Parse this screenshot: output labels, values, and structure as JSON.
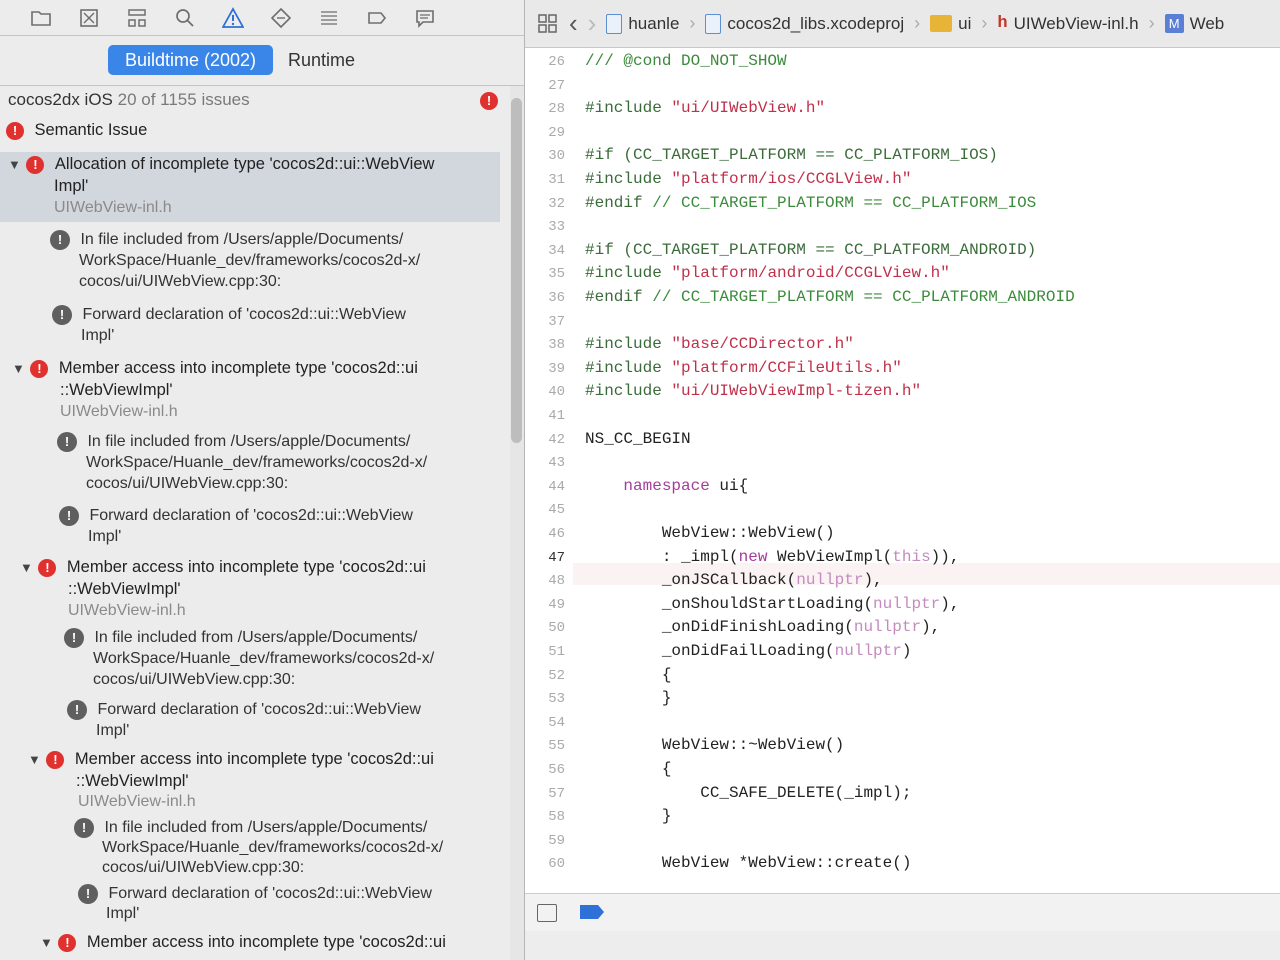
{
  "toolbar_icons": [
    "folder-icon",
    "source-control-icon",
    "hierarchy-icon",
    "search-icon",
    "warning-icon",
    "test-icon",
    "debug-icon",
    "breakpoint-icon",
    "report-icon"
  ],
  "scope": {
    "buildtime_label": "Buildtime (2002)",
    "runtime_label": "Runtime"
  },
  "summary": {
    "project": "cocos2dx iOS",
    "count": "20 of 1155 issues",
    "error_badge": "!"
  },
  "category": "Semantic Issue",
  "issues": [
    {
      "title_l1": "Allocation of incomplete type 'cocos2d::ui::WebView",
      "title_l2": "Impl'",
      "file": "UIWebView-inl.h",
      "note1_l1": "In file included from /Users/apple/Documents/",
      "note1_l2": "WorkSpace/Huanle_dev/frameworks/cocos2d-x/",
      "note1_l3": "cocos/ui/UIWebView.cpp:30:",
      "note2_l1": "Forward declaration of 'cocos2d::ui::WebView",
      "note2_l2": "Impl'"
    },
    {
      "title_l1": "Member access into incomplete type 'cocos2d::ui",
      "title_l2": "::WebViewImpl'",
      "file": "UIWebView-inl.h",
      "note1_l1": "In file included from /Users/apple/Documents/",
      "note1_l2": "WorkSpace/Huanle_dev/frameworks/cocos2d-x/",
      "note1_l3": "cocos/ui/UIWebView.cpp:30:",
      "note2_l1": "Forward declaration of 'cocos2d::ui::WebView",
      "note2_l2": "Impl'"
    },
    {
      "title_l1": "Member access into incomplete type 'cocos2d::ui",
      "title_l2": "::WebViewImpl'",
      "file": "UIWebView-inl.h",
      "note1_l1": "In file included from /Users/apple/Documents/",
      "note1_l2": "WorkSpace/Huanle_dev/frameworks/cocos2d-x/",
      "note1_l3": "cocos/ui/UIWebView.cpp:30:",
      "note2_l1": "Forward declaration of 'cocos2d::ui::WebView",
      "note2_l2": "Impl'"
    },
    {
      "title_l1": "Member access into incomplete type 'cocos2d::ui",
      "title_l2": "::WebViewImpl'",
      "file": "UIWebView-inl.h",
      "note1_l1": "In file included from /Users/apple/Documents/",
      "note1_l2": "WorkSpace/Huanle_dev/frameworks/cocos2d-x/",
      "note1_l3": "cocos/ui/UIWebView.cpp:30:",
      "note2_l1": "Forward declaration of 'cocos2d::ui::WebView",
      "note2_l2": "Impl'"
    },
    {
      "title_l1": "Member access into incomplete type 'cocos2d::ui"
    }
  ],
  "jumpbar": {
    "project": "huanle",
    "xcodeproj": "cocos2d_libs.xcodeproj",
    "folder": "ui",
    "file": "UIWebView-inl.h",
    "symbol": "Web",
    "h_glyph": "h",
    "m_glyph": "M"
  },
  "code": {
    "current_line": "47",
    "lines": [
      {
        "n": "26",
        "parts": [
          {
            "c": "cm",
            "t": "/// @cond DO_NOT_SHOW"
          }
        ]
      },
      {
        "n": "27",
        "parts": []
      },
      {
        "n": "28",
        "parts": [
          {
            "c": "pp",
            "t": "#include "
          },
          {
            "c": "str",
            "t": "\"ui/UIWebView.h\""
          }
        ]
      },
      {
        "n": "29",
        "parts": []
      },
      {
        "n": "30",
        "parts": [
          {
            "c": "pp",
            "t": "#if (CC_TARGET_PLATFORM == CC_PLATFORM_IOS)"
          }
        ]
      },
      {
        "n": "31",
        "parts": [
          {
            "c": "pp",
            "t": "#include "
          },
          {
            "c": "str",
            "t": "\"platform/ios/CCGLView.h\""
          }
        ]
      },
      {
        "n": "32",
        "parts": [
          {
            "c": "pp",
            "t": "#endif "
          },
          {
            "c": "cm",
            "t": "// CC_TARGET_PLATFORM == CC_PLATFORM_IOS"
          }
        ]
      },
      {
        "n": "33",
        "parts": []
      },
      {
        "n": "34",
        "parts": [
          {
            "c": "pp",
            "t": "#if (CC_TARGET_PLATFORM == CC_PLATFORM_ANDROID)"
          }
        ]
      },
      {
        "n": "35",
        "parts": [
          {
            "c": "pp",
            "t": "#include "
          },
          {
            "c": "str",
            "t": "\"platform/android/CCGLView.h\""
          }
        ]
      },
      {
        "n": "36",
        "parts": [
          {
            "c": "pp",
            "t": "#endif "
          },
          {
            "c": "cm",
            "t": "// CC_TARGET_PLATFORM == CC_PLATFORM_ANDROID"
          }
        ]
      },
      {
        "n": "37",
        "parts": []
      },
      {
        "n": "38",
        "parts": [
          {
            "c": "pp",
            "t": "#include "
          },
          {
            "c": "str",
            "t": "\"base/CCDirector.h\""
          }
        ]
      },
      {
        "n": "39",
        "parts": [
          {
            "c": "pp",
            "t": "#include "
          },
          {
            "c": "str",
            "t": "\"platform/CCFileUtils.h\""
          }
        ]
      },
      {
        "n": "40",
        "parts": [
          {
            "c": "pp",
            "t": "#include "
          },
          {
            "c": "str",
            "t": "\"ui/UIWebViewImpl-tizen.h\""
          }
        ]
      },
      {
        "n": "41",
        "parts": []
      },
      {
        "n": "42",
        "parts": [
          {
            "c": "",
            "t": "NS_CC_BEGIN"
          }
        ]
      },
      {
        "n": "43",
        "parts": []
      },
      {
        "n": "44",
        "parts": [
          {
            "c": "",
            "t": "    "
          },
          {
            "c": "kw",
            "t": "namespace"
          },
          {
            "c": "",
            "t": " ui{"
          }
        ]
      },
      {
        "n": "45",
        "parts": []
      },
      {
        "n": "46",
        "parts": [
          {
            "c": "",
            "t": "        WebView::WebView()"
          }
        ]
      },
      {
        "n": "47",
        "parts": [
          {
            "c": "",
            "t": "        : _impl("
          },
          {
            "c": "kw",
            "t": "new"
          },
          {
            "c": "",
            "t": " WebViewImpl("
          },
          {
            "c": "nul",
            "t": "this"
          },
          {
            "c": "",
            "t": ")),"
          }
        ]
      },
      {
        "n": "48",
        "parts": [
          {
            "c": "",
            "t": "        _onJSCallback("
          },
          {
            "c": "nul",
            "t": "nullptr"
          },
          {
            "c": "",
            "t": "),"
          }
        ]
      },
      {
        "n": "49",
        "parts": [
          {
            "c": "",
            "t": "        _onShouldStartLoading("
          },
          {
            "c": "nul",
            "t": "nullptr"
          },
          {
            "c": "",
            "t": "),"
          }
        ]
      },
      {
        "n": "50",
        "parts": [
          {
            "c": "",
            "t": "        _onDidFinishLoading("
          },
          {
            "c": "nul",
            "t": "nullptr"
          },
          {
            "c": "",
            "t": "),"
          }
        ]
      },
      {
        "n": "51",
        "parts": [
          {
            "c": "",
            "t": "        _onDidFailLoading("
          },
          {
            "c": "nul",
            "t": "nullptr"
          },
          {
            "c": "",
            "t": ")"
          }
        ]
      },
      {
        "n": "52",
        "parts": [
          {
            "c": "",
            "t": "        {"
          }
        ]
      },
      {
        "n": "53",
        "parts": [
          {
            "c": "",
            "t": "        }"
          }
        ]
      },
      {
        "n": "54",
        "parts": []
      },
      {
        "n": "55",
        "parts": [
          {
            "c": "",
            "t": "        WebView::~WebView()"
          }
        ]
      },
      {
        "n": "56",
        "parts": [
          {
            "c": "",
            "t": "        {"
          }
        ]
      },
      {
        "n": "57",
        "parts": [
          {
            "c": "",
            "t": "            CC_SAFE_DELETE(_impl);"
          }
        ]
      },
      {
        "n": "58",
        "parts": [
          {
            "c": "",
            "t": "        }"
          }
        ]
      },
      {
        "n": "59",
        "parts": []
      },
      {
        "n": "60",
        "parts": [
          {
            "c": "",
            "t": "        WebView *WebView::create()"
          }
        ]
      }
    ]
  }
}
